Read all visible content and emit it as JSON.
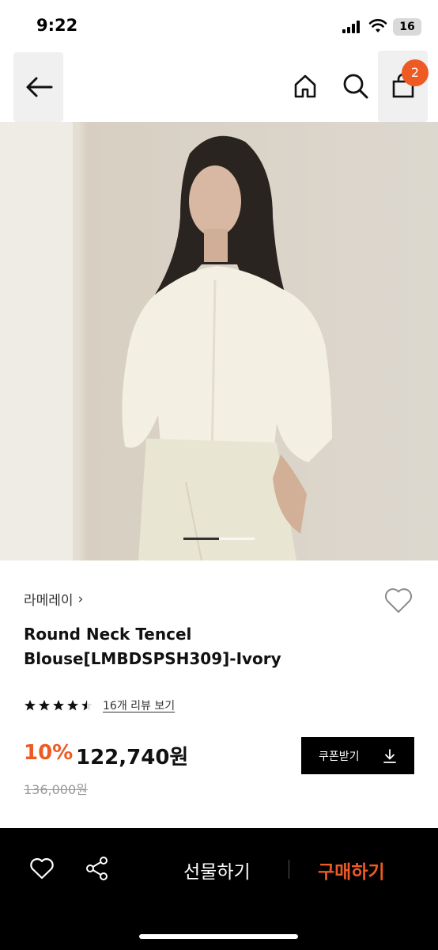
{
  "status_bar": {
    "time": "9:22",
    "battery": "16"
  },
  "nav": {
    "back_icon": "arrow-left-icon",
    "home_icon": "home-icon",
    "search_icon": "search-icon",
    "cart_icon": "shopping-bag-icon",
    "cart_count": "2"
  },
  "gallery": {
    "current_index": 1,
    "total": 2
  },
  "product": {
    "brand": "라메레이",
    "title": "Round Neck Tencel Blouse[LMBDSPSH309]-Ivory",
    "rating": 4.5,
    "review_link": "16개 리뷰 보기",
    "discount": "10%",
    "price": "122,740원",
    "original_price": "136,000원",
    "coupon_label": "쿠폰받기"
  },
  "bottom_bar": {
    "gift_label": "선물하기",
    "buy_label": "구매하기"
  },
  "colors": {
    "accent": "#ee5a24",
    "bar_bg": "#000000"
  }
}
